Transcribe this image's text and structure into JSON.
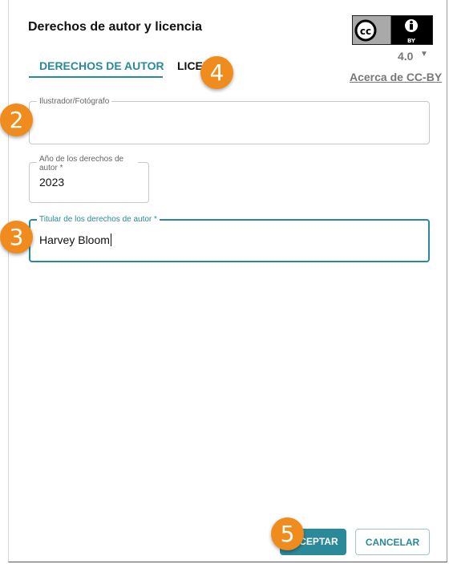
{
  "dialog": {
    "title": "Derechos de autor y licencia",
    "license_badge": {
      "icons": [
        "cc-icon",
        "by-person-icon"
      ],
      "by_text": "BY"
    },
    "version": "4.0",
    "about_link": "Acerca de CC-BY"
  },
  "tabs": [
    {
      "label": "DERECHOS DE AUTOR",
      "active": true
    },
    {
      "label": "LICEN"
    }
  ],
  "fields": {
    "illustrator": {
      "label": "Ilustrador/Fotógrafo",
      "value": ""
    },
    "year": {
      "label_line1": "Año de los derechos de",
      "label_line2": "autor *",
      "value": "2023"
    },
    "holder": {
      "label": "Titular de los derechos de autor *",
      "value": "Harvey Bloom"
    }
  },
  "buttons": {
    "ok": "ACEPTAR",
    "cancel": "CANCELAR"
  },
  "ok_visible": "CEPTAR",
  "markers": [
    "2",
    "3",
    "4",
    "5"
  ],
  "colors": {
    "accent": "#2a8a9a",
    "marker": "#f08c1d"
  }
}
